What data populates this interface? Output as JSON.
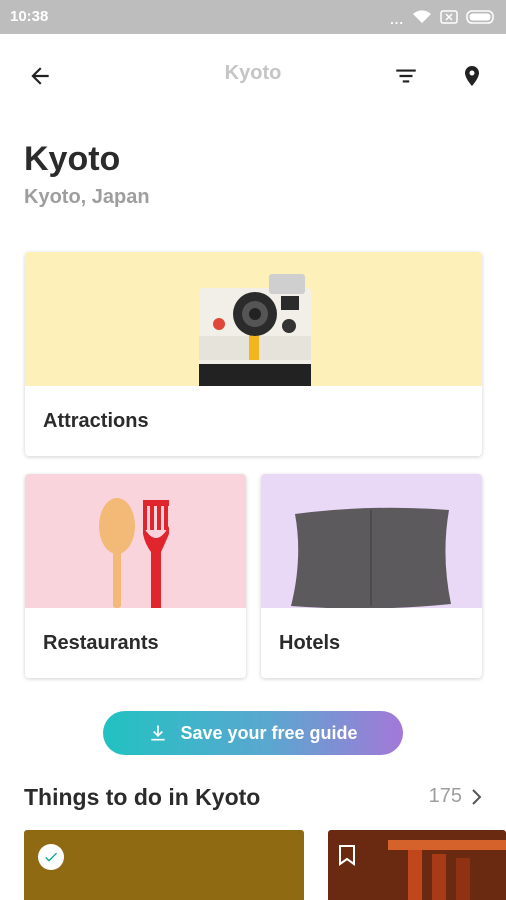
{
  "status_bar": {
    "time": "10:38",
    "dots": "..."
  },
  "app_bar": {
    "title": "Kyoto"
  },
  "header": {
    "title": "Kyoto",
    "subtitle": "Kyoto, Japan"
  },
  "categories": [
    {
      "label": "Attractions",
      "color": "#fdf0b8",
      "icon": "camera-icon"
    },
    {
      "label": "Restaurants",
      "color": "#fad4dc",
      "icon": "spoon-fork-icon"
    },
    {
      "label": "Hotels",
      "color": "#e9d8f6",
      "icon": "pillow-icon"
    }
  ],
  "save_button": {
    "label": "Save your free guide"
  },
  "things_to_do": {
    "title": "Things to do in Kyoto",
    "count": "175"
  },
  "colors": {
    "accent_start": "#22c2c1",
    "accent_end": "#a378d8",
    "status_bar": "#bdbdbd"
  }
}
